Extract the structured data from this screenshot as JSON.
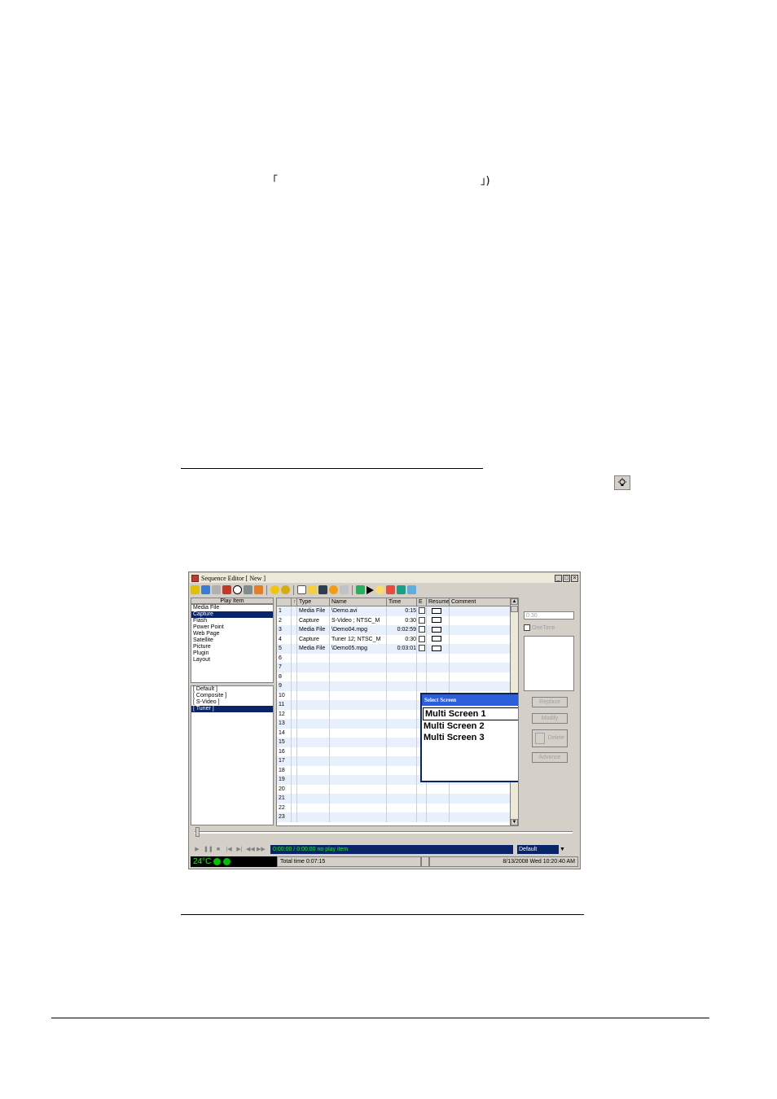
{
  "doc": {
    "open_bracket": "「",
    "close_bracket": "」)"
  },
  "window": {
    "title": "Sequence Editor [ New ]",
    "minimize_glyph": "_",
    "maximize_glyph": "□",
    "close_glyph": "×",
    "play_item_header": "Play Item",
    "play_items": [
      "Media File",
      "Capture",
      "Flash",
      "Power Point",
      "Web Page",
      "Satellite",
      "Picture",
      "Plugin",
      "Layout"
    ],
    "play_items_selected": "Capture",
    "sources": [
      "[ Default ]",
      "[ Composite ]",
      "[ S-Video ]",
      "[ Tuner ]"
    ],
    "sources_selected": "[ Tuner ]",
    "columns": [
      "",
      "↑",
      "Type",
      "Name",
      "Time",
      "E",
      "Resume",
      "Comment"
    ],
    "rows": [
      {
        "no": "1",
        "type": "Media File",
        "name": "\\Demo.avi",
        "time": "0:15"
      },
      {
        "no": "2",
        "type": "Capture",
        "name": "S-Video ; NTSC_M",
        "time": "0:30"
      },
      {
        "no": "3",
        "type": "Media File",
        "name": "\\Demo04.mpg",
        "time": "0:02:59"
      },
      {
        "no": "4",
        "type": "Capture",
        "name": "Tuner 12; NTSC_M",
        "time": "0:30"
      },
      {
        "no": "5",
        "type": "Media File",
        "name": "\\Demo05.mpg",
        "time": "0:03:01"
      },
      {
        "no": "6"
      },
      {
        "no": "7"
      },
      {
        "no": "8"
      },
      {
        "no": "9"
      },
      {
        "no": "10"
      },
      {
        "no": "11"
      },
      {
        "no": "12"
      },
      {
        "no": "13"
      },
      {
        "no": "14"
      },
      {
        "no": "15"
      },
      {
        "no": "16"
      },
      {
        "no": "17"
      },
      {
        "no": "18"
      },
      {
        "no": "19"
      },
      {
        "no": "20"
      },
      {
        "no": "21"
      },
      {
        "no": "22"
      },
      {
        "no": "23"
      }
    ],
    "right_panel": {
      "time_value": "0:30",
      "one_time_label": "OneTime",
      "buttons": [
        "Replace",
        "Modify",
        "Delete",
        "Advance"
      ]
    },
    "transport": {
      "buttons": [
        "▶",
        "❚❚",
        "■",
        "|◀",
        "▶|",
        "◀◀",
        "▶▶"
      ],
      "status_text": "0:00:00 / 0:00:00  no play item",
      "profile": "Default",
      "profile_arrow": "▼"
    },
    "status": {
      "temperature": "24°C",
      "total_time": "Total time 0:07:15",
      "datetime": "8/13/2008 Wed 10:20:40 AM"
    },
    "dialog": {
      "title": "Select Screen",
      "close_glyph": "×",
      "options": [
        "Multi Screen 1",
        "Multi Screen 2",
        "Multi Screen 3"
      ]
    }
  },
  "colors": {
    "selection": "#0a246a",
    "dialog_title": "#2b5ed8",
    "lcd_text": "#00ff00"
  }
}
